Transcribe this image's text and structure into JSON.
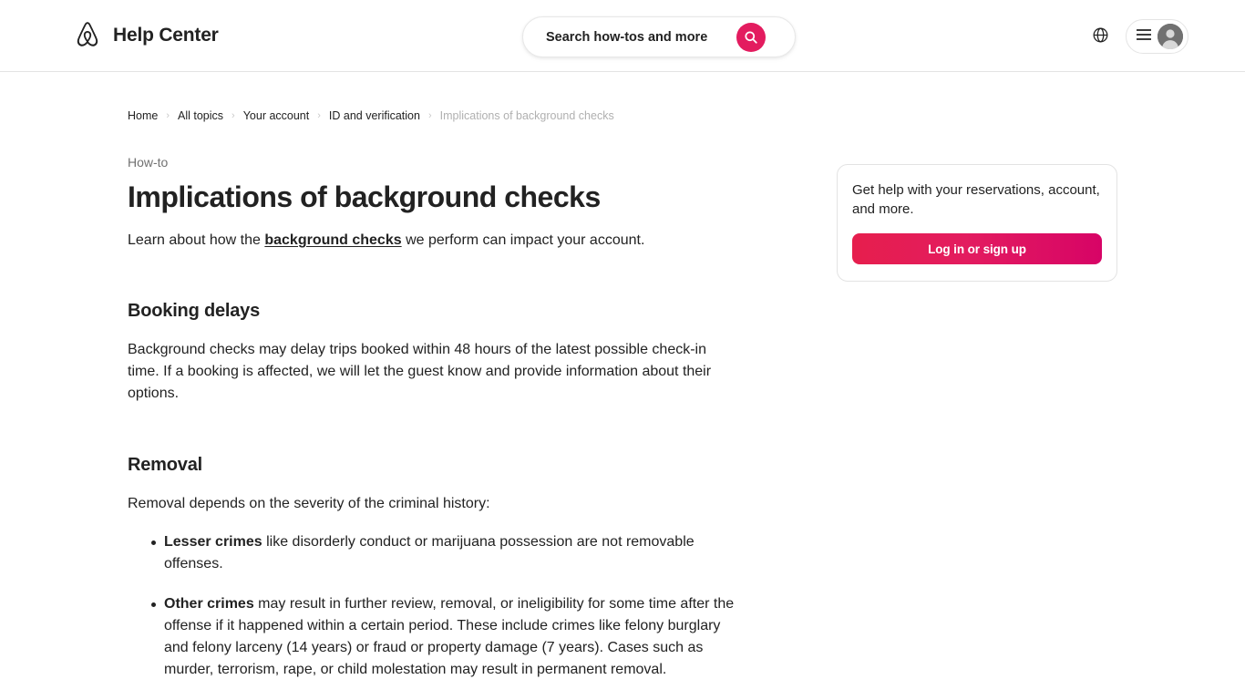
{
  "header": {
    "brand_label": "Help Center",
    "brand_logo_icon": "airbnb-logo-icon",
    "search": {
      "placeholder": "Search how-tos and more",
      "value": "",
      "button_icon": "search-icon"
    },
    "language_icon": "globe-icon",
    "menu_icon": "hamburger-menu-icon",
    "avatar_icon": "user-avatar-icon"
  },
  "breadcrumb": {
    "items": [
      {
        "label": "Home",
        "current": false
      },
      {
        "label": "All topics",
        "current": false
      },
      {
        "label": "Your account",
        "current": false
      },
      {
        "label": "ID and verification",
        "current": false
      },
      {
        "label": "Implications of background checks",
        "current": true
      }
    ],
    "separator": "›"
  },
  "article": {
    "eyebrow": "How-to",
    "title": "Implications of background checks",
    "lede_before": "Learn about how the ",
    "lede_link": "background checks",
    "lede_after": " we perform can impact your account.",
    "sections": [
      {
        "heading": "Booking delays",
        "paragraph": "Background checks may delay trips booked within 48 hours of the latest possible check-in time. If a booking is affected, we will let the guest know and provide information about their options."
      },
      {
        "heading": "Removal",
        "paragraph": "Removal depends on the severity of the criminal history:",
        "bullets": [
          {
            "lead": "Lesser crimes",
            "rest": " like disorderly conduct or marijuana possession are not removable offenses."
          },
          {
            "lead": "Other crimes",
            "rest": " may result in further review, removal, or ineligibility for some time after the offense if it happened within a certain period. These include crimes like felony burglary and felony larceny (14 years) or fraud or property damage (7 years). Cases such as murder, terrorism, rape, or child molestation may result in permanent removal."
          }
        ]
      }
    ]
  },
  "sidebar": {
    "help_card": {
      "text": "Get help with your reservations, account, and more.",
      "button_label": "Log in or sign up"
    }
  },
  "colors": {
    "accent_pink": "#E31C5F",
    "accent_gradient_start": "#E61E4D",
    "accent_gradient_end": "#D70466",
    "text_primary": "#222222",
    "text_muted": "#717171",
    "border": "#e4e4e4"
  }
}
